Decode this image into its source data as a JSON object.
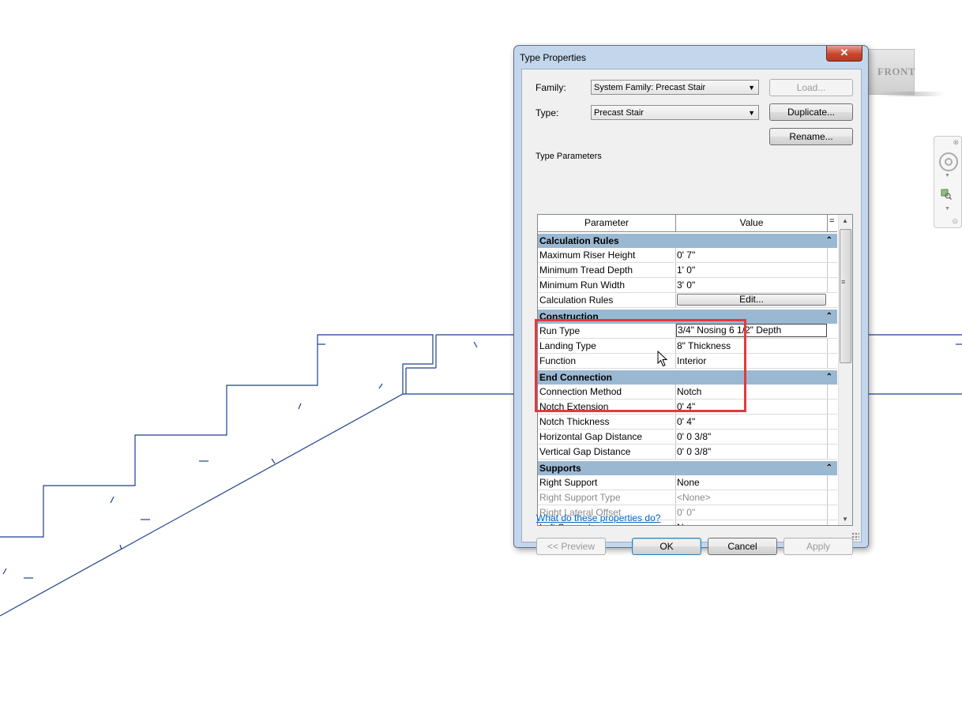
{
  "viewcube": {
    "label": "FRONT"
  },
  "dialog": {
    "title": "Type Properties",
    "close_label": "✕",
    "family_label": "Family:",
    "family_value": "System Family: Precast Stair",
    "type_label": "Type:",
    "type_value": "Precast Stair",
    "load_label": "Load...",
    "duplicate_label": "Duplicate...",
    "rename_label": "Rename...",
    "type_parameters_label": "Type Parameters",
    "grid": {
      "col_parameter": "Parameter",
      "col_value": "Value",
      "col_extra": "=",
      "groups": [
        {
          "name": "Calculation Rules",
          "rows": [
            {
              "param": "Maximum Riser Height",
              "value": "0'  7\""
            },
            {
              "param": "Minimum Tread Depth",
              "value": "1'  0\""
            },
            {
              "param": "Minimum Run Width",
              "value": "3'  0\""
            },
            {
              "param": "Calculation Rules",
              "value": "Edit..."
            }
          ]
        },
        {
          "name": "Construction",
          "rows": [
            {
              "param": "Run Type",
              "value": "3/4\" Nosing 6 1/2\" Depth"
            },
            {
              "param": "Landing Type",
              "value": "8\" Thickness"
            },
            {
              "param": "Function",
              "value": "Interior"
            }
          ]
        },
        {
          "name": "End Connection",
          "rows": [
            {
              "param": "Connection Method",
              "value": "Notch"
            },
            {
              "param": "Notch Extension",
              "value": "0'  4\""
            },
            {
              "param": "Notch Thickness",
              "value": "0'  4\""
            },
            {
              "param": "Horizontal Gap Distance",
              "value": "0'  0 3/8\""
            },
            {
              "param": "Vertical Gap Distance",
              "value": "0'  0 3/8\""
            }
          ]
        },
        {
          "name": "Supports",
          "rows": [
            {
              "param": "Right Support",
              "value": "None"
            },
            {
              "param": "Right Support Type",
              "value": "<None>"
            },
            {
              "param": "Right Lateral Offset",
              "value": "0'  0\""
            },
            {
              "param": "Left Support",
              "value": "None"
            }
          ]
        }
      ]
    },
    "help_link": "What do these properties do?",
    "preview_label": "<< Preview",
    "ok_label": "OK",
    "cancel_label": "Cancel",
    "apply_label": "Apply"
  },
  "colors": {
    "stair_line": "#1f3f8f",
    "highlight": "#e2393f",
    "group_header": "#9bb8d3"
  }
}
